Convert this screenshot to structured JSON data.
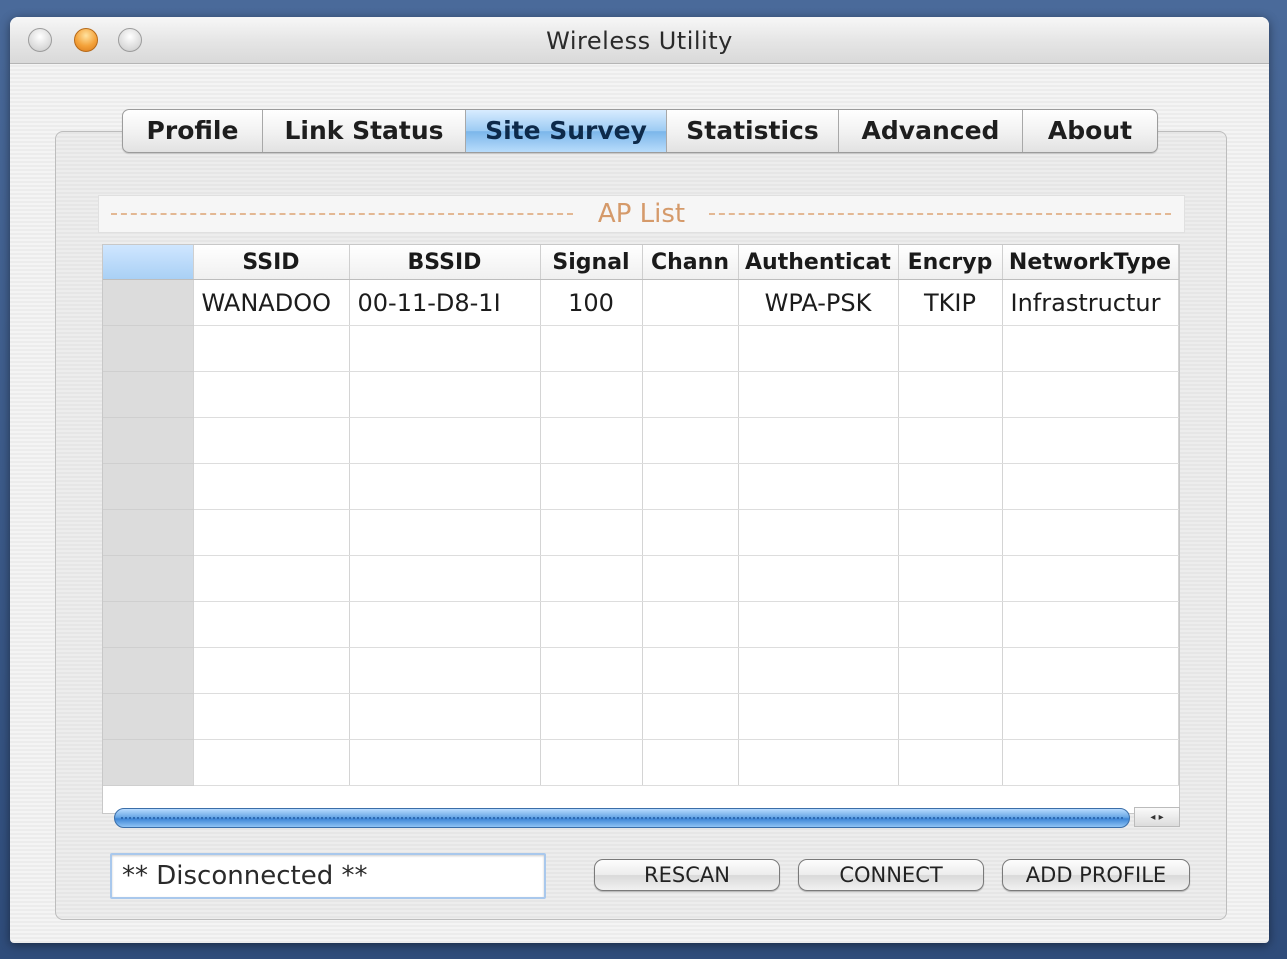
{
  "window": {
    "title": "Wireless Utility"
  },
  "tabs": [
    {
      "label": "Profile",
      "active": false
    },
    {
      "label": "Link Status",
      "active": false
    },
    {
      "label": "Site Survey",
      "active": true
    },
    {
      "label": "Statistics",
      "active": false
    },
    {
      "label": "Advanced",
      "active": false
    },
    {
      "label": "About",
      "active": false
    }
  ],
  "ap_list": {
    "title": "AP List",
    "columns": [
      "SSID",
      "BSSID",
      "Signal",
      "Chann",
      "Authenticat",
      "Encryp",
      "NetworkType"
    ],
    "rows": [
      [
        "WANADOO",
        "00-11-D8-1I",
        "100",
        "",
        "WPA-PSK",
        "TKIP",
        "Infrastructur"
      ]
    ]
  },
  "status": {
    "text": "** Disconnected **"
  },
  "buttons": {
    "rescan": "RESCAN",
    "connect": "CONNECT",
    "add_profile": "ADD PROFILE"
  },
  "scrollbar": {
    "left_arrow": "◂",
    "right_arrow": "▸"
  }
}
